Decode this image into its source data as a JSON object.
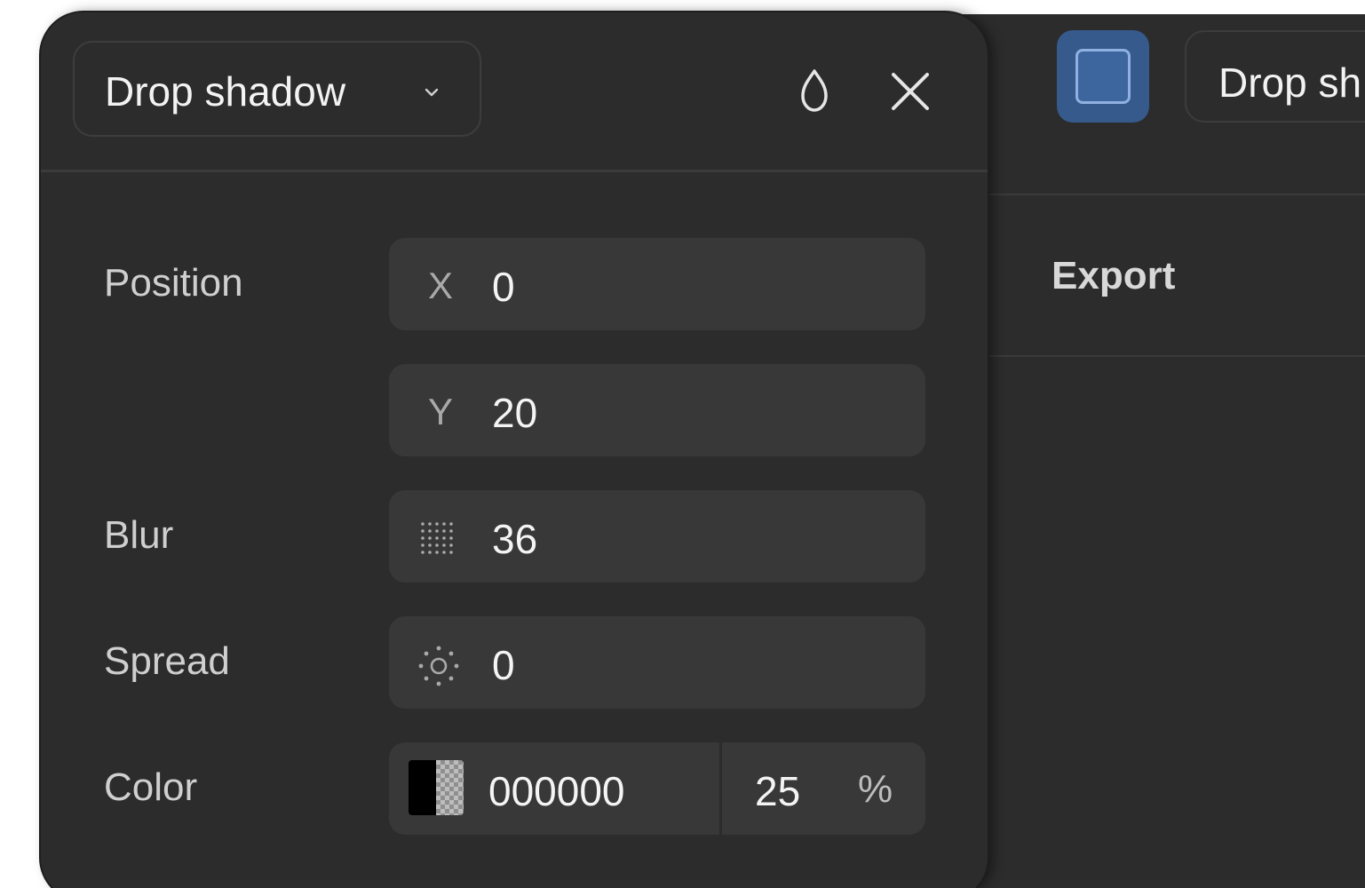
{
  "effect_panel": {
    "effect_type": "Drop shadow",
    "icons": {
      "dropdown": "chevron-down-icon",
      "visibility": "drop-icon",
      "close": "close-icon",
      "blur": "blur-grid-icon",
      "spread": "spread-sun-icon"
    },
    "rows": {
      "position": {
        "label": "Position",
        "x_prefix": "X",
        "x_value": "0",
        "y_prefix": "Y",
        "y_value": "20"
      },
      "blur": {
        "label": "Blur",
        "value": "36"
      },
      "spread": {
        "label": "Spread",
        "value": "0"
      },
      "color": {
        "label": "Color",
        "swatch_color": "#000000",
        "hex": "000000",
        "opacity": "25",
        "opacity_unit": "%"
      }
    }
  },
  "background_panel": {
    "effect_type": "Drop sh",
    "section_title": "Export",
    "icons": {
      "effect_preview": "square-outline-icon"
    }
  },
  "colors": {
    "panel_bg": "#2c2c2c",
    "field_bg": "#383838",
    "accent_blue": "#365a8c"
  }
}
